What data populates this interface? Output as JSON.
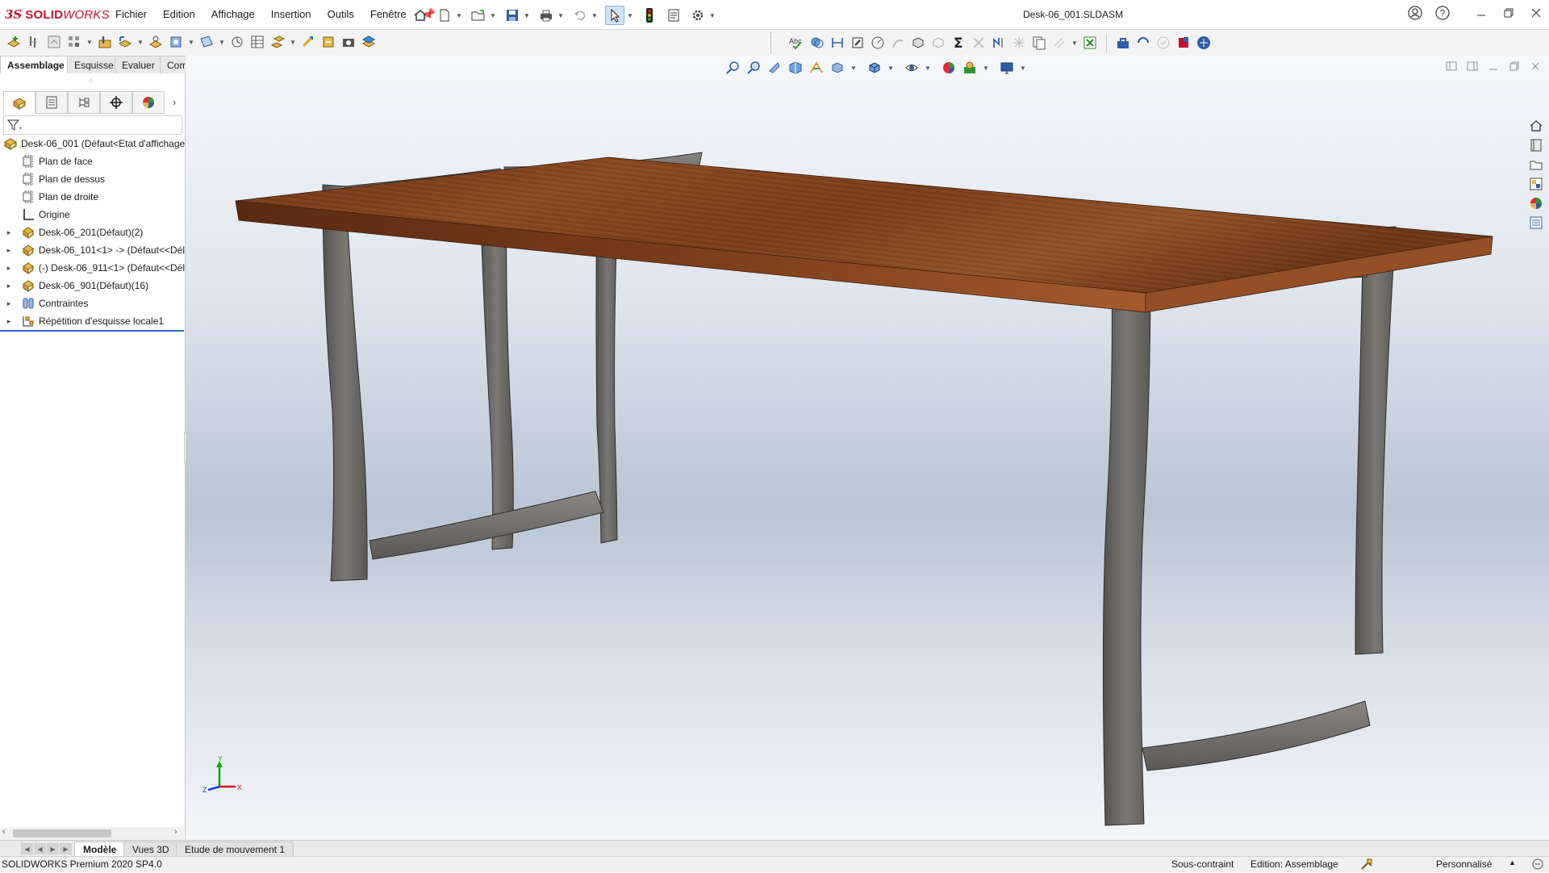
{
  "app": {
    "logo_ds": "3S",
    "logo_brand_bold": "SOLID",
    "logo_brand_italic": "WORKS",
    "document_title": "Desk-06_001.SLDASM"
  },
  "menu": [
    "Fichier",
    "Edition",
    "Affichage",
    "Insertion",
    "Outils",
    "Fenêtre"
  ],
  "command_tabs": [
    {
      "label": "Assemblage",
      "active": true
    },
    {
      "label": "Esquisse",
      "active": false
    },
    {
      "label": "Evaluer",
      "active": false
    },
    {
      "label": "Compléments de SOLIDWORKS",
      "active": false
    }
  ],
  "feature_tree": {
    "root": "Desk-06_001  (Défaut<Etat d'affichage",
    "items": [
      {
        "label": "Plan de face",
        "icon": "plane-icon",
        "expandable": false
      },
      {
        "label": "Plan de dessus",
        "icon": "plane-icon",
        "expandable": false
      },
      {
        "label": "Plan de droite",
        "icon": "plane-icon",
        "expandable": false
      },
      {
        "label": "Origine",
        "icon": "origin-icon",
        "expandable": false
      },
      {
        "label": "Desk-06_201(Défaut)(2)",
        "icon": "part-icon",
        "expandable": true
      },
      {
        "label": "Desk-06_101<1> -> (Défaut<<Dél",
        "icon": "part-icon",
        "expandable": true
      },
      {
        "label": "(-) Desk-06_911<1> (Défaut<<Dél",
        "icon": "part-icon",
        "expandable": true
      },
      {
        "label": "Desk-06_901(Défaut)(16)",
        "icon": "part-icon",
        "expandable": true
      },
      {
        "label": "Contraintes",
        "icon": "mates-icon",
        "expandable": true
      },
      {
        "label": "Répétition d'esquisse locale1",
        "icon": "pattern-icon",
        "expandable": true
      }
    ]
  },
  "bottom_tabs": [
    {
      "label": "Modèle",
      "active": true
    },
    {
      "label": "Vues 3D",
      "active": false
    },
    {
      "label": "Etude de mouvement 1",
      "active": false
    }
  ],
  "status": {
    "version": "SOLIDWORKS Premium 2020 SP4.0",
    "constraint": "Sous-contraint",
    "editing": "Edition: Assemblage",
    "units": "Personnalisé"
  },
  "triad": {
    "y": "Y",
    "z": "Z",
    "x": "X"
  },
  "colors": {
    "accent": "#2a6ebd",
    "brand": "#c8102e",
    "wood": "#7a3f1c",
    "steel": "#6f6d6a"
  }
}
